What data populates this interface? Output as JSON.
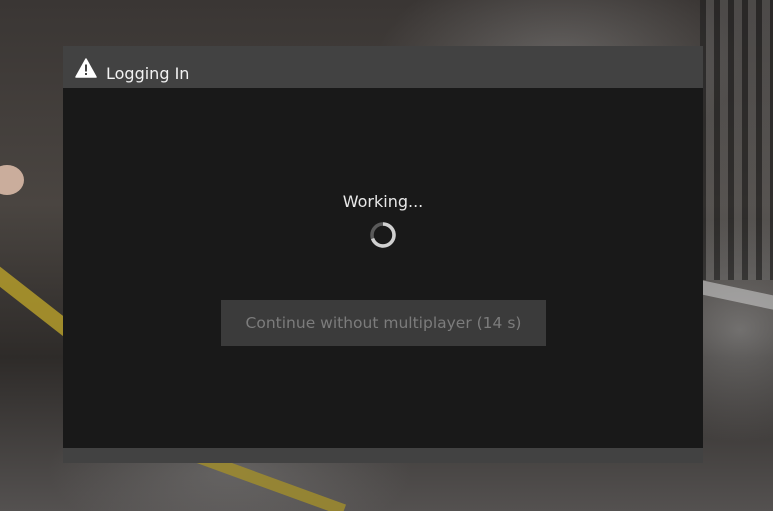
{
  "dialog": {
    "title": "Logging In",
    "title_icon": "warning-icon",
    "status_text": "Working...",
    "spinner_icon": "loading-spinner-icon",
    "continue_button_label": "Continue without multiplayer (14 s)"
  },
  "colors": {
    "dialog_frame": "#424242",
    "dialog_body": "#161616",
    "button_bg": "#3b3b3b",
    "button_text_disabled": "#7c7c7c",
    "title_text": "#f2f2f2"
  }
}
